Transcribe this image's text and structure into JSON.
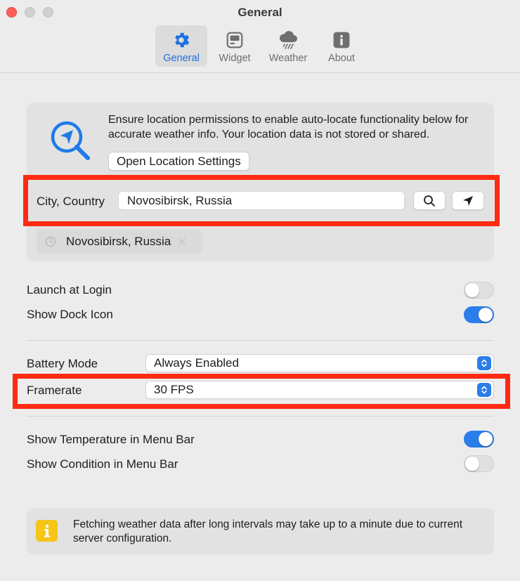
{
  "window": {
    "title": "General"
  },
  "tabs": [
    {
      "label": "General",
      "icon": "gear-icon",
      "active": true
    },
    {
      "label": "Widget",
      "icon": "widget-icon",
      "active": false
    },
    {
      "label": "Weather",
      "icon": "cloud-rain-icon",
      "active": false
    },
    {
      "label": "About",
      "icon": "info-icon",
      "active": false
    }
  ],
  "location": {
    "description": "Ensure location permissions to enable auto-locate functionality below for accurate weather info. Your location data is not stored or shared.",
    "open_settings_label": "Open Location Settings",
    "city_label": "City, Country",
    "city_value": "Novosibirsk, Russia",
    "recent": "Novosibirsk, Russia"
  },
  "settings": {
    "launch_at_login": {
      "label": "Launch at Login",
      "on": false
    },
    "show_dock_icon": {
      "label": "Show Dock Icon",
      "on": true
    },
    "battery_mode": {
      "label": "Battery Mode",
      "value": "Always Enabled"
    },
    "framerate": {
      "label": "Framerate",
      "value": "30 FPS"
    },
    "show_temperature": {
      "label": "Show Temperature in Menu Bar",
      "on": true
    },
    "show_condition": {
      "label": "Show Condition in Menu Bar",
      "on": false
    }
  },
  "info": {
    "text": "Fetching weather data after long intervals may take up to a minute due to current server configuration."
  },
  "colors": {
    "accent": "#2b7de9",
    "active_tab_text": "#1f6fe0",
    "highlight": "#ff2a12",
    "info_icon": "#f5c518"
  }
}
